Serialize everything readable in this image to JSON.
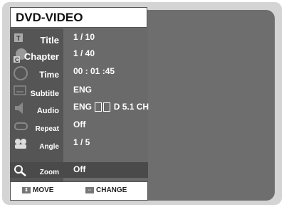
{
  "osd_title": "DVD-VIDEO",
  "rows": [
    {
      "label": "Title",
      "value": "1 / 10",
      "icon": "title-icon"
    },
    {
      "label": "Chapter",
      "value": "1 / 40",
      "icon": "chapter-icon"
    },
    {
      "label": "Time",
      "value": "00 : 01 :45",
      "icon": "time-icon"
    },
    {
      "label": "Subtitle",
      "value": "ENG",
      "icon": "subtitle-icon"
    },
    {
      "label": "Audio",
      "value_pre": "ENG",
      "value_post": "D 5.1 CH",
      "icon": "audio-icon"
    },
    {
      "label": "Repeat",
      "value": "Off",
      "icon": "repeat-icon"
    },
    {
      "label": "Angle",
      "value": "1 / 5",
      "icon": "angle-icon"
    },
    {
      "label": "Zoom",
      "value": "Off",
      "icon": "zoom-icon",
      "selected": true
    }
  ],
  "footer": {
    "move": "MOVE",
    "change": "CHANGE"
  },
  "colors": {
    "screen_bg": "#6e6e6e",
    "left_column": "#555555",
    "highlight": "#4a4a4a"
  }
}
